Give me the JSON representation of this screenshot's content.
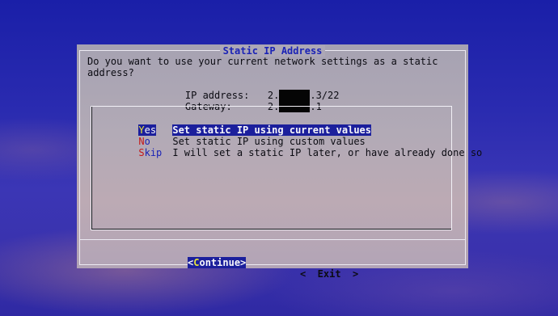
{
  "dialog": {
    "title": "Static IP Address",
    "question": "Do you want to use your current network settings as a static\naddress?",
    "ip_label": "IP address:",
    "ip_prefix": "2.",
    "ip_suffix": ".3/22",
    "gateway_label": "Gateway:",
    "gateway_prefix": "2.",
    "gateway_suffix": ".1"
  },
  "menu": {
    "items": [
      {
        "tag_hot": "Y",
        "tag_rest": "es",
        "description": "Set static IP using current values",
        "selected": true
      },
      {
        "tag_hot": "N",
        "tag_rest": "o",
        "description": "Set static IP using custom values",
        "selected": false
      },
      {
        "tag_hot": "S",
        "tag_rest": "kip",
        "description": "I will set a static IP later, or have already done so",
        "selected": false
      }
    ]
  },
  "buttons": {
    "continue_open": "<",
    "continue_hot": "C",
    "continue_rest": "ontinue",
    "continue_close": ">",
    "exit_label": "<  Exit  >"
  },
  "colors": {
    "selection": "#1b1f9c",
    "hotkey": "#c41818",
    "title": "#1b23b6"
  }
}
